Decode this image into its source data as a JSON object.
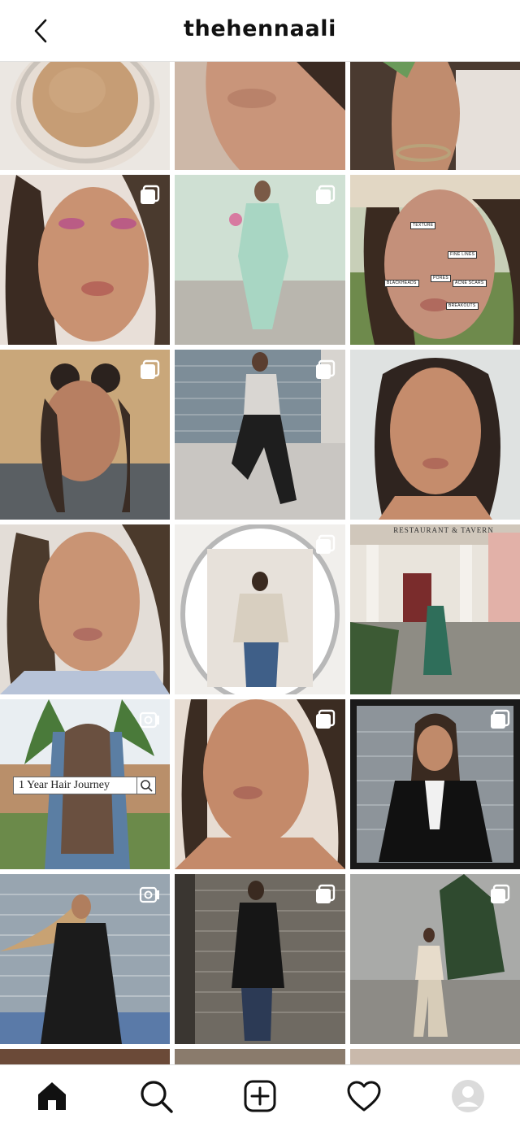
{
  "header": {
    "username": "thehennaali",
    "back_icon": "chevron-left-icon"
  },
  "posts": [
    {
      "id": "r0c0",
      "badge": null
    },
    {
      "id": "r0c1",
      "badge": null
    },
    {
      "id": "r0c2",
      "badge": null
    },
    {
      "id": "r1c0",
      "badge": "carousel"
    },
    {
      "id": "r1c1",
      "badge": "carousel"
    },
    {
      "id": "r1c2",
      "badge": null,
      "tags": [
        "TEXTURE",
        "FINE LINES",
        "BLACKHEADS",
        "PORES",
        "ACNE SCARS",
        "BREAKOUTS"
      ]
    },
    {
      "id": "r2c0",
      "badge": "carousel"
    },
    {
      "id": "r2c1",
      "badge": "carousel"
    },
    {
      "id": "r2c2",
      "badge": null
    },
    {
      "id": "r3c0",
      "badge": null
    },
    {
      "id": "r3c1",
      "badge": "carousel"
    },
    {
      "id": "r3c2",
      "badge": null,
      "sign": "RESTAURANT & TAVERN"
    },
    {
      "id": "r4c0",
      "badge": "igtv",
      "overlay": "1 Year Hair Journey"
    },
    {
      "id": "r4c1",
      "badge": "carousel"
    },
    {
      "id": "r4c2",
      "badge": "carousel"
    },
    {
      "id": "r5c0",
      "badge": "igtv"
    },
    {
      "id": "r5c1",
      "badge": "carousel"
    },
    {
      "id": "r5c2",
      "badge": "carousel"
    }
  ],
  "bottom_nav": [
    {
      "name": "home",
      "icon": "home-icon",
      "active": true
    },
    {
      "name": "search",
      "icon": "search-icon",
      "active": false
    },
    {
      "name": "new-post",
      "icon": "plus-square-icon",
      "active": false
    },
    {
      "name": "activity",
      "icon": "heart-icon",
      "active": false
    },
    {
      "name": "profile",
      "icon": "avatar-icon",
      "active": false
    }
  ],
  "colors": {
    "text": "#111111",
    "divider": "#e0e0e0",
    "background": "#ffffff"
  }
}
